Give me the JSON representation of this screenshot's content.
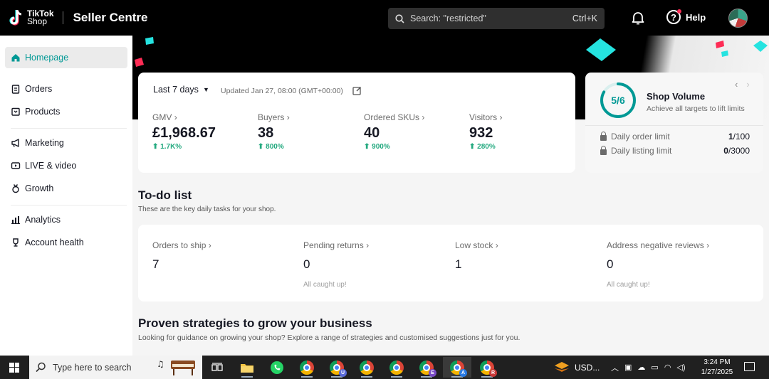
{
  "header": {
    "logo_line1": "TikTok",
    "logo_line2": "Shop",
    "title": "Seller Centre",
    "search_placeholder": "Search: \"restricted\"",
    "search_shortcut": "Ctrl+K",
    "help_label": "Help"
  },
  "sidebar": {
    "items": [
      {
        "label": "Homepage",
        "icon": "home-icon",
        "active": true
      },
      {
        "label": "Orders",
        "icon": "clipboard-icon"
      },
      {
        "label": "Products",
        "icon": "box-icon"
      },
      {
        "label": "Marketing",
        "icon": "megaphone-icon"
      },
      {
        "label": "LIVE & video",
        "icon": "video-icon"
      },
      {
        "label": "Growth",
        "icon": "medal-icon"
      },
      {
        "label": "Analytics",
        "icon": "bar-chart-icon"
      },
      {
        "label": "Account health",
        "icon": "trophy-icon"
      }
    ]
  },
  "stats": {
    "range": "Last 7 days",
    "updated": "Updated Jan 27, 08:00 (GMT+00:00)",
    "metrics": [
      {
        "label": "GMV",
        "value": "£1,968.67",
        "change": "1.7K%"
      },
      {
        "label": "Buyers",
        "value": "38",
        "change": "800%"
      },
      {
        "label": "Ordered SKUs",
        "value": "40",
        "change": "900%"
      },
      {
        "label": "Visitors",
        "value": "932",
        "change": "280%"
      }
    ]
  },
  "shop_volume": {
    "progress_text": "5/6",
    "progress_fraction": 0.8333,
    "title": "Shop Volume",
    "subtitle": "Achieve all targets to lift limits",
    "limits": [
      {
        "label": "Daily order limit",
        "current": "1",
        "max": "/100"
      },
      {
        "label": "Daily listing limit",
        "current": "0",
        "max": "/3000"
      }
    ]
  },
  "todo": {
    "title": "To-do list",
    "subtitle": "These are the key daily tasks for your shop.",
    "items": [
      {
        "label": "Orders to ship",
        "value": "7",
        "note": ""
      },
      {
        "label": "Pending returns",
        "value": "0",
        "note": "All caught up!"
      },
      {
        "label": "Low stock",
        "value": "1",
        "note": ""
      },
      {
        "label": "Address negative reviews",
        "value": "0",
        "note": "All caught up!"
      }
    ]
  },
  "strategies": {
    "title": "Proven strategies to grow your business",
    "subtitle": "Looking for guidance on growing your shop? Explore a range of strategies and customised suggestions just for you."
  },
  "taskbar": {
    "search_placeholder": "Type here to search",
    "currency": "USD...",
    "time": "3:24 PM",
    "date": "1/27/2025",
    "profile_badges": [
      "",
      "U",
      "",
      "",
      "E",
      "A",
      "R"
    ],
    "badge_colors": [
      "",
      "#5b6bd8",
      "",
      "#d86a2b",
      "#7a4cc6",
      "#2a7be4",
      "#c93a3a"
    ]
  },
  "colors": {
    "accent": "#009995",
    "positive": "#23a97f",
    "confetti_teal": "#25e3e0",
    "confetti_pink": "#fe2c55"
  }
}
